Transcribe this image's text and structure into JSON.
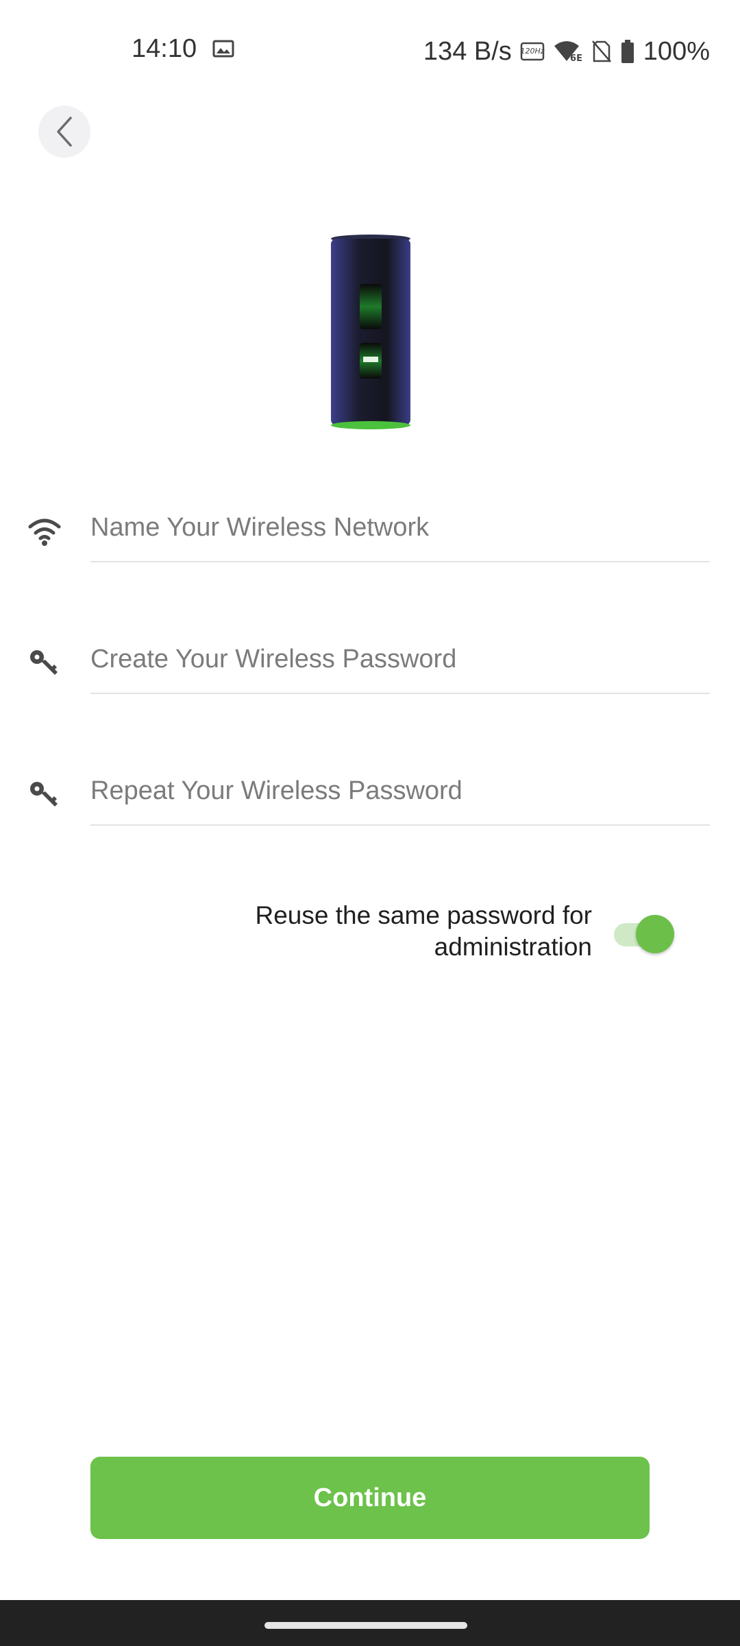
{
  "status_bar": {
    "time": "14:10",
    "net_speed": "134 B/s",
    "refresh_rate": "120Hz",
    "wifi_badge": "6E",
    "battery": "100%",
    "icons": [
      "gallery-icon",
      "refresh-rate-icon",
      "wifi-6e-icon",
      "no-sim-icon",
      "battery-icon"
    ]
  },
  "header": {
    "back_icon": "chevron-left-icon"
  },
  "device_image": {
    "name": "router-device"
  },
  "form": {
    "network_name": {
      "placeholder": "Name Your Wireless Network",
      "value": "",
      "icon": "wifi-icon"
    },
    "password": {
      "placeholder": "Create Your Wireless Password",
      "value": "",
      "icon": "key-icon"
    },
    "repeat_password": {
      "placeholder": "Repeat Your Wireless Password",
      "value": "",
      "icon": "key-icon"
    }
  },
  "reuse_toggle": {
    "label_line1": "Reuse the same password for",
    "label_line2": "administration",
    "enabled": true
  },
  "continue_button": {
    "label": "Continue"
  },
  "colors": {
    "accent": "#6cc24a",
    "toggle_track": "#cfe9c6",
    "nav_bar": "#222222"
  }
}
